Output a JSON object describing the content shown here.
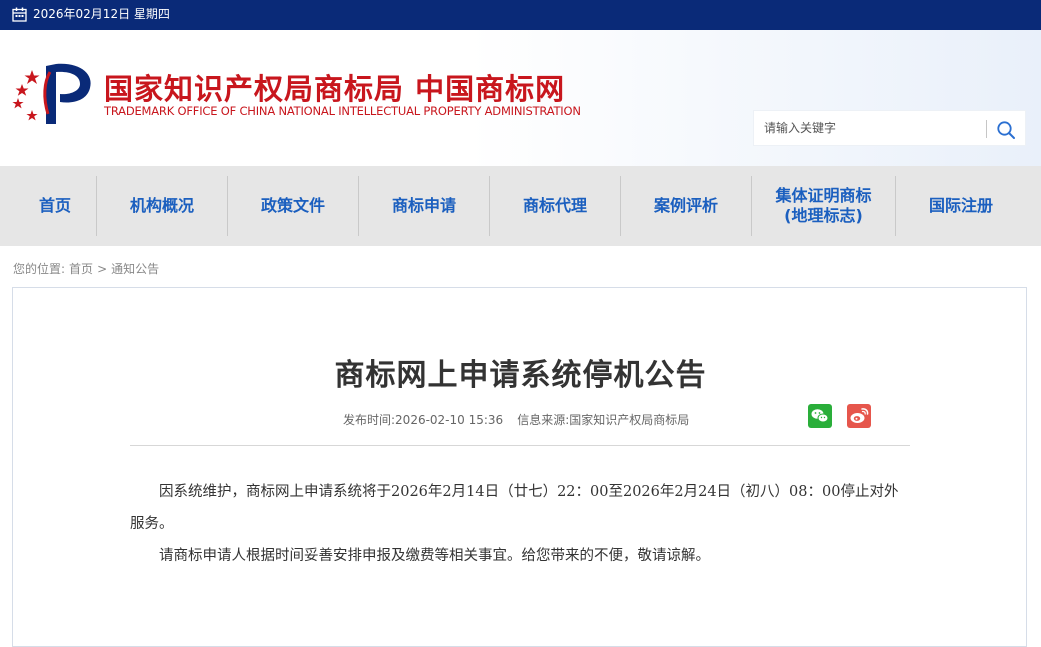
{
  "topbar": {
    "date": "2026年02月12日 星期四"
  },
  "header": {
    "site_name_cn": "国家知识产权局商标局 中国商标网",
    "site_name_en": "TRADEMARK OFFICE OF CHINA NATIONAL INTELLECTUAL PROPERTY ADMINISTRATION",
    "search": {
      "placeholder": "请输入关键字"
    }
  },
  "nav": {
    "items": [
      {
        "label": "首页"
      },
      {
        "label": "机构概况"
      },
      {
        "label": "政策文件"
      },
      {
        "label": "商标申请"
      },
      {
        "label": "商标代理"
      },
      {
        "label": "案例评析"
      },
      {
        "label": "集体证明商标\n(地理标志)"
      },
      {
        "label": "国际注册"
      }
    ]
  },
  "breadcrumb": {
    "prefix": "您的位置:",
    "home": "首页",
    "sep": ">",
    "current": "通知公告"
  },
  "article": {
    "title": "商标网上申请系统停机公告",
    "publish_label": "发布时间:",
    "publish_time": "2026-02-10 15:36",
    "source_label": "信息来源:",
    "source": "国家知识产权局商标局",
    "paragraphs": [
      "因系统维护，商标网上申请系统将于2026年2月14日（廿七）22：00至2026年2月24日（初八）08：00停止对外服务。",
      "请商标申请人根据时间妥善安排申报及缴费等相关事宜。给您带来的不便，敬请谅解。"
    ]
  },
  "icons": {
    "calendar": "calendar-icon",
    "search": "search-icon",
    "wechat": "wechat-icon",
    "weibo": "weibo-icon"
  },
  "colors": {
    "topbar_bg": "#0a2a78",
    "brand_red": "#c8161d",
    "nav_text": "#1b5fbf",
    "nav_bg": "#e6e6e6",
    "wechat_green": "#2aae3a",
    "weibo_red": "#e6564c"
  }
}
